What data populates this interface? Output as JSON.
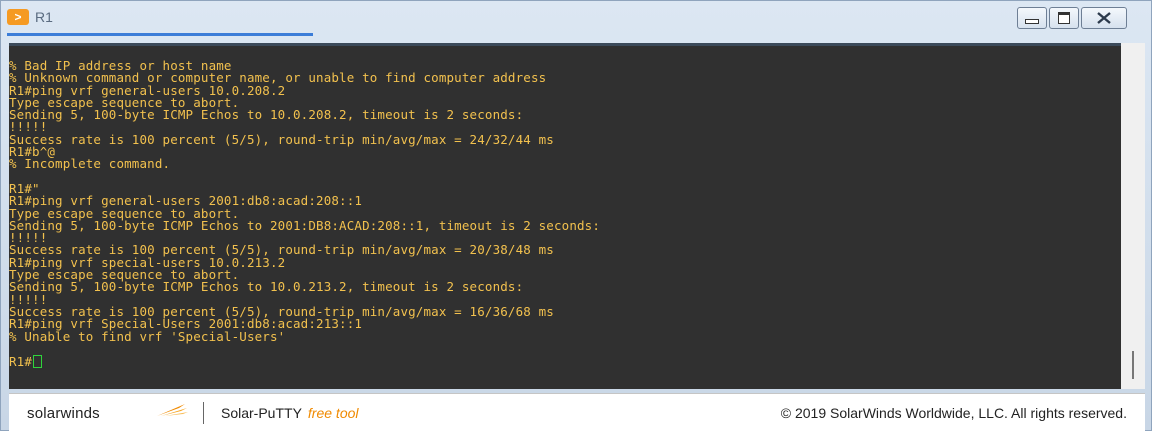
{
  "window": {
    "title": "R1",
    "app_icon": "putty-icon",
    "controls": {
      "minimize": "minimize-icon",
      "maximize": "maximize-icon",
      "close": "close-icon"
    }
  },
  "terminal": {
    "text_color": "#f2c14e",
    "background": "#303030",
    "lines": [
      "% Bad IP address or host name",
      "% Unknown command or computer name, or unable to find computer address",
      "R1#ping vrf general-users 10.0.208.2",
      "Type escape sequence to abort.",
      "Sending 5, 100-byte ICMP Echos to 10.0.208.2, timeout is 2 seconds:",
      "!!!!!",
      "Success rate is 100 percent (5/5), round-trip min/avg/max = 24/32/44 ms",
      "R1#b^@",
      "% Incomplete command.",
      "",
      "R1#\"",
      "R1#ping vrf general-users 2001:db8:acad:208::1",
      "Type escape sequence to abort.",
      "Sending 5, 100-byte ICMP Echos to 2001:DB8:ACAD:208::1, timeout is 2 seconds:",
      "!!!!!",
      "Success rate is 100 percent (5/5), round-trip min/avg/max = 20/38/48 ms",
      "R1#ping vrf special-users 10.0.213.2",
      "Type escape sequence to abort.",
      "Sending 5, 100-byte ICMP Echos to 10.0.213.2, timeout is 2 seconds:",
      "!!!!!",
      "Success rate is 100 percent (5/5), round-trip min/avg/max = 16/36/68 ms",
      "R1#ping vrf Special-Users 2001:db8:acad:213::1",
      "% Unable to find vrf 'Special-Users'",
      ""
    ],
    "prompt": "R1#"
  },
  "statusbar": {
    "logo_text": "solarwinds",
    "product": "Solar-PuTTY",
    "product_tag": "free tool",
    "copyright": "© 2019 SolarWinds Worldwide, LLC. All rights reserved.",
    "accent": "#f08a00"
  }
}
